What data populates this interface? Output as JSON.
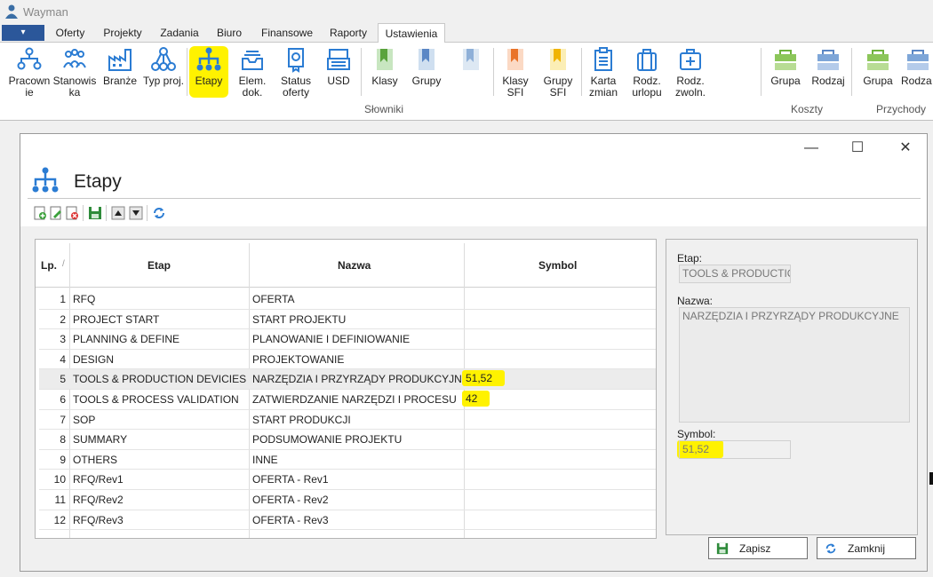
{
  "app": {
    "title": "Wayman"
  },
  "menu": {
    "app_button": "▾",
    "tabs": [
      {
        "label": "Oferty"
      },
      {
        "label": "Projekty"
      },
      {
        "label": "Zadania"
      },
      {
        "label": "Biuro"
      },
      {
        "label": "Finansowe"
      },
      {
        "label": "Raporty"
      },
      {
        "label": "Ustawienia",
        "active": true
      }
    ]
  },
  "ribbon": {
    "buttons": [
      {
        "label1": "Pracown",
        "label2": "ie",
        "icon": "people-tree-icon"
      },
      {
        "label1": "Stanowis",
        "label2": "ka",
        "icon": "people-group-icon"
      },
      {
        "label1": "Branże",
        "label2": "",
        "icon": "factory-icon"
      },
      {
        "label1": "Typ proj.",
        "label2": "",
        "icon": "network-icon"
      },
      {
        "label1": "Etapy",
        "label2": "",
        "icon": "hierarchy-icon",
        "highlighted": true
      },
      {
        "label1": "Elem.",
        "label2": "dok.",
        "icon": "inbox-tray-icon"
      },
      {
        "label1": "Status",
        "label2": "oferty",
        "icon": "certificate-icon"
      },
      {
        "label1": "USD",
        "label2": "",
        "icon": "register-icon"
      },
      {
        "label1": "Klasy",
        "label2": "",
        "icon": "bookmark-green-icon"
      },
      {
        "label1": "Grupy",
        "label2": "",
        "icon": "bookmark-blue-icon"
      },
      {
        "label1": "",
        "label2": "",
        "icon": "bookmark-lightblue-icon"
      },
      {
        "label1": "Klasy",
        "label2": "SFI",
        "icon": "bookmark-orange-icon"
      },
      {
        "label1": "Grupy",
        "label2": "SFI",
        "icon": "bookmark-yellow-icon"
      },
      {
        "label1": "Karta",
        "label2": "zmian",
        "icon": "clipboard-icon"
      },
      {
        "label1": "Rodz.",
        "label2": "urlopu",
        "icon": "suitcase-icon"
      },
      {
        "label1": "Rodz.",
        "label2": "zwoln.",
        "icon": "medical-kit-icon"
      },
      {
        "label1": "Grupa",
        "label2": "",
        "icon": "tray-green-icon"
      },
      {
        "label1": "Rodzaj",
        "label2": "",
        "icon": "tray-blue-icon"
      },
      {
        "label1": "Grupa",
        "label2": "",
        "icon": "tray-green-icon"
      },
      {
        "label1": "Rodza",
        "label2": "",
        "icon": "tray-blue-icon"
      }
    ],
    "groups": {
      "slowniki": "Słowniki",
      "koszty": "Koszty",
      "przychody": "Przychody"
    }
  },
  "dialog": {
    "title": "Etapy",
    "window_buttons": {
      "minimize": "—",
      "maximize": "☐",
      "close": "✕"
    },
    "toolbar": [
      "add-icon",
      "edit-icon",
      "delete-icon",
      "save-icon",
      "move-up-icon",
      "move-down-icon",
      "refresh-icon"
    ],
    "grid": {
      "columns": {
        "lp": "Lp.",
        "lp_sort": "/",
        "etap": "Etap",
        "nazwa": "Nazwa",
        "symbol": "Symbol"
      },
      "rows": [
        {
          "lp": "1",
          "etap": "RFQ",
          "nazwa": "OFERTA",
          "symbol": ""
        },
        {
          "lp": "2",
          "etap": "PROJECT START",
          "nazwa": "START PROJEKTU",
          "symbol": ""
        },
        {
          "lp": "3",
          "etap": "PLANNING & DEFINE",
          "nazwa": "PLANOWANIE I DEFINIOWANIE",
          "symbol": ""
        },
        {
          "lp": "4",
          "etap": "DESIGN",
          "nazwa": "PROJEKTOWANIE",
          "symbol": ""
        },
        {
          "lp": "5",
          "etap": "TOOLS & PRODUCTION DEVICIES",
          "nazwa": "NARZĘDZIA I PRZYRZĄDY PRODUKCYJNE",
          "symbol": "51,52",
          "selected": true
        },
        {
          "lp": "6",
          "etap": "TOOLS & PROCESS VALIDATION",
          "nazwa": "ZATWIERDZANIE NARZĘDZI I PROCESU",
          "symbol": "42"
        },
        {
          "lp": "7",
          "etap": "SOP",
          "nazwa": "START PRODUKCJI",
          "symbol": ""
        },
        {
          "lp": "8",
          "etap": "SUMMARY",
          "nazwa": "PODSUMOWANIE PROJEKTU",
          "symbol": ""
        },
        {
          "lp": "9",
          "etap": "OTHERS",
          "nazwa": "INNE",
          "symbol": ""
        },
        {
          "lp": "10",
          "etap": "RFQ/Rev1",
          "nazwa": "OFERTA - Rev1",
          "symbol": ""
        },
        {
          "lp": "11",
          "etap": "RFQ/Rev2",
          "nazwa": "OFERTA - Rev2",
          "symbol": ""
        },
        {
          "lp": "12",
          "etap": "RFQ/Rev3",
          "nazwa": "OFERTA - Rev3",
          "symbol": ""
        }
      ]
    },
    "detail": {
      "etap_label": "Etap:",
      "etap_value": "TOOLS & PRODUCTIO",
      "nazwa_label": "Nazwa:",
      "nazwa_value": "NARZĘDZIA I PRZYRZĄDY PRODUKCYJNE",
      "symbol_label": "Symbol:",
      "symbol_value": "51,52"
    },
    "buttons": {
      "save": "Zapisz",
      "close": "Zamknij"
    }
  },
  "colors": {
    "highlight": "#fff200",
    "app_button": "#2b579a",
    "accent_blue": "#2b7cd3"
  }
}
